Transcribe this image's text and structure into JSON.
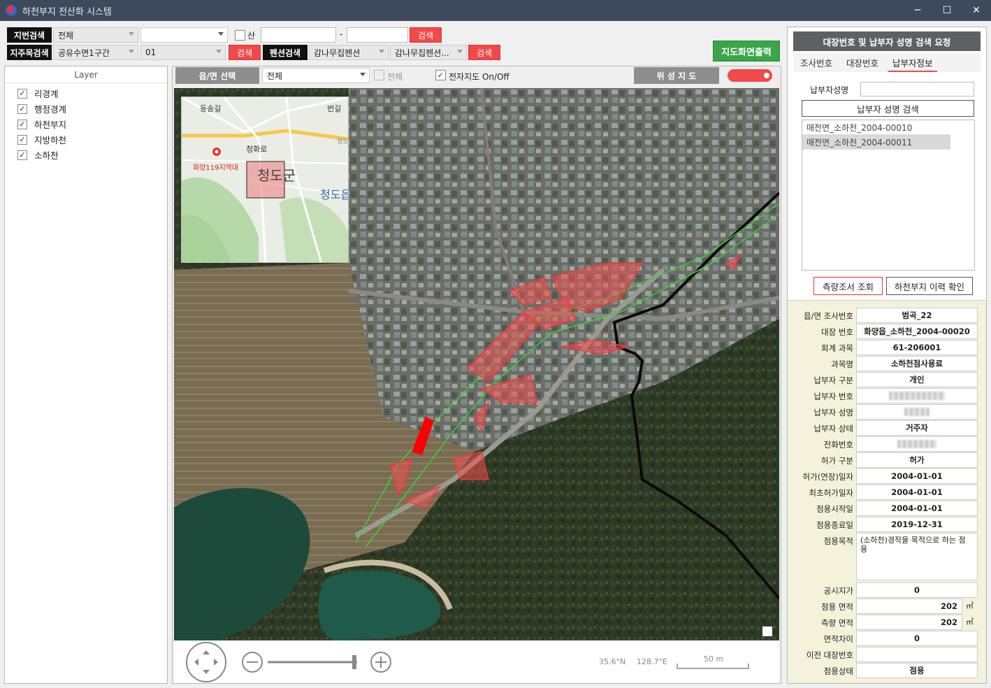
{
  "window": {
    "title": "하천부지 전산화 시스템",
    "controls": [
      "─",
      "☐",
      "✕"
    ]
  },
  "search": {
    "row1": {
      "label": "지번검색",
      "combo1": "전체",
      "combo2": "",
      "san_label": "산",
      "dash": "-",
      "button": "검색"
    },
    "row2": {
      "label": "지주목검색",
      "combo1": "공유수면1구간",
      "combo2": "01",
      "button": "검색",
      "pension_label": "펜션검색",
      "pension_combo1": "감나무집펜션",
      "pension_combo2": "감나무집펜션...",
      "pension_button": "검색"
    },
    "print_button": "지도화면출력"
  },
  "layers": {
    "header": "Layer",
    "items": [
      {
        "label": "리경계",
        "checked": true
      },
      {
        "label": "행정경계",
        "checked": true
      },
      {
        "label": "하천부지",
        "checked": true
      },
      {
        "label": "지방하천",
        "checked": true
      },
      {
        "label": "소하천",
        "checked": true
      }
    ]
  },
  "map": {
    "town_select_button": "읍/면 선택",
    "town_combo": "전체",
    "all_checkbox_label": "전체",
    "ecmap_checkbox_label": "전자지도 On/Off",
    "satellite_button": "위 성 지 도",
    "minimap": {
      "labels": [
        "동송길",
        "청화로",
        "화양119지역대",
        "청도군",
        "청도읍",
        "번길",
        "청도"
      ]
    },
    "bottom": {
      "lat": "35.6°N",
      "lon": "128.7°E",
      "scale": "50 m"
    }
  },
  "right": {
    "title": "대장번호 및 납부자 성명 검색 요청",
    "tabs": [
      "조사번호",
      "대장번호",
      "납부자정보"
    ],
    "active_tab": "납부자정보",
    "name_label": "납부자성명",
    "name_search_button": "납부자 성명 검색",
    "results": [
      "매전면_소하천_2004-00010",
      "매전면_소하천_2004-00011"
    ],
    "selected_result": 1,
    "survey_button": "측량조서 조회",
    "history_button": "하천부지 이력 확인",
    "details": [
      {
        "label": "읍/면 조사번호",
        "value": "범곡_22"
      },
      {
        "label": "대장 번호",
        "value": "화양읍_소하천_2004-00020"
      },
      {
        "label": "회계 과목",
        "value": "61-206001"
      },
      {
        "label": "과목명",
        "value": "소하천점사용료"
      },
      {
        "label": "납부자 구분",
        "value": "개인"
      },
      {
        "label": "납부자 번호",
        "value": ""
      },
      {
        "label": "납부자 성명",
        "value": ""
      },
      {
        "label": "납부자 상태",
        "value": "거주자"
      },
      {
        "label": "전화번호",
        "value": ""
      },
      {
        "label": "허가 구분",
        "value": "허가"
      },
      {
        "label": "허가(연장)일자",
        "value": "2004-01-01"
      },
      {
        "label": "최초허가일자",
        "value": "2004-01-01"
      },
      {
        "label": "점용시작일",
        "value": "2004-01-01"
      },
      {
        "label": "점용종료일",
        "value": "2019-12-31"
      }
    ],
    "purpose_label": "점용목적",
    "purpose_value": "(소하천)경작을 목적으로 하는 점용",
    "details2": [
      {
        "label": "공시지가",
        "value": "0"
      },
      {
        "label": "점용 면적",
        "value": "202",
        "unit": "㎡"
      },
      {
        "label": "측량 면적",
        "value": "202",
        "unit": "㎡"
      },
      {
        "label": "면적차이",
        "value": "0"
      },
      {
        "label": "이전 대장번호",
        "value": ""
      },
      {
        "label": "점용상태",
        "value": "점용"
      }
    ]
  }
}
